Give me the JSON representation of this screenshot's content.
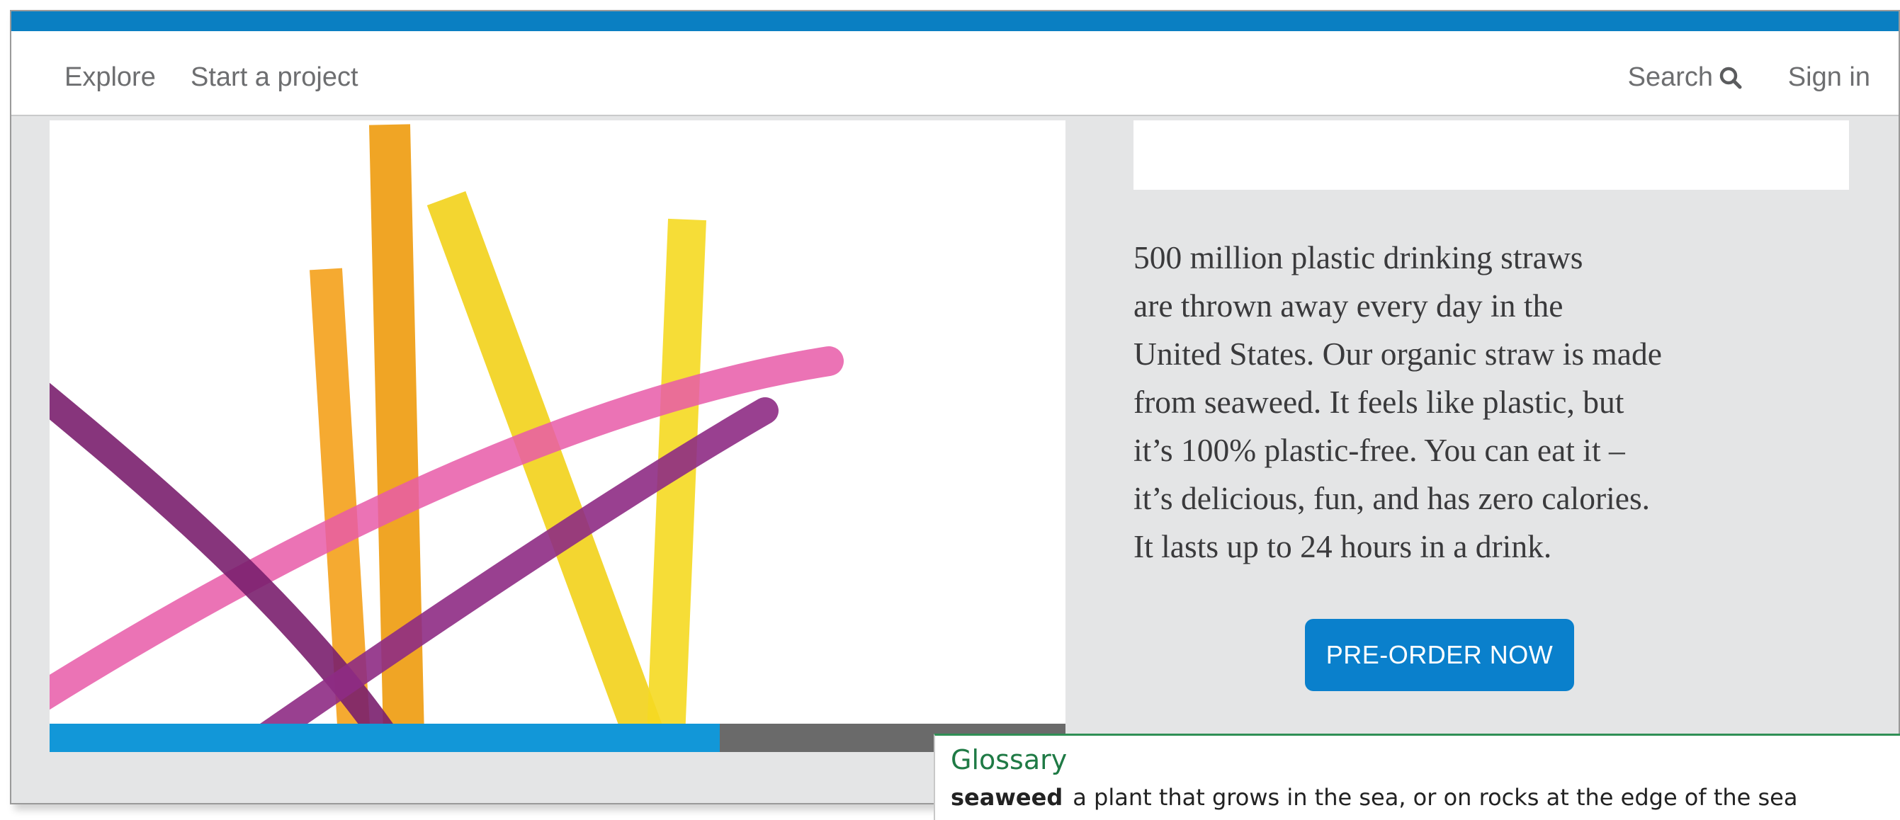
{
  "nav": {
    "explore": "Explore",
    "start_project": "Start a project",
    "search": "Search",
    "sign_in": "Sign in"
  },
  "hero": {
    "image_icon": "colorful-seaweed-straws-image",
    "progress": 0.66
  },
  "content": {
    "description_lines": [
      "500 million plastic drinking straws",
      "are thrown away every day in the",
      "United States. Our organic straw is made",
      "from seaweed. It feels like plastic, but",
      "it’s 100% plastic-free. You can eat it –",
      "it’s delicious, fun, and has zero calories.",
      "It lasts up to 24 hours in a drink."
    ],
    "cta_label": "PRE-ORDER NOW"
  },
  "glossary": {
    "title": "Glossary",
    "term": "seaweed",
    "definition": "a plant that grows in the sea, or on rocks at the edge of the sea"
  },
  "colors": {
    "brand_blue": "#0a7fc2",
    "cta_blue": "#0a80cc",
    "progress_blue": "#1297d8",
    "glossary_green": "#1f7a45"
  }
}
